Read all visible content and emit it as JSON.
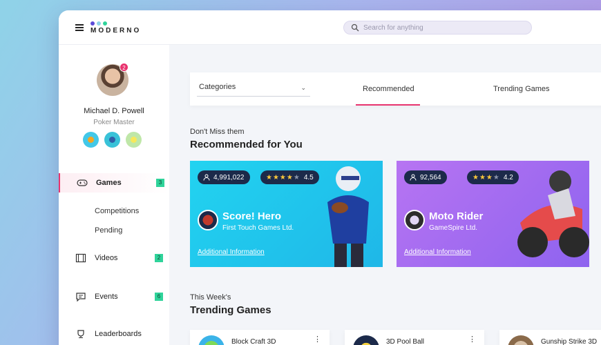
{
  "app": {
    "brand": "MODERNO",
    "search_placeholder": "Search for anything",
    "logo_colors": [
      "#5c4bd8",
      "#8fd3e8",
      "#2fd39a"
    ]
  },
  "user": {
    "name": "Michael D. Powell",
    "role": "Poker Master",
    "notification_count": "2"
  },
  "sidebar": {
    "items": [
      {
        "label": "Games",
        "count": "3",
        "icon": "gamepad-icon"
      },
      {
        "label": "Competitions"
      },
      {
        "label": "Pending"
      },
      {
        "label": "Videos",
        "count": "2",
        "icon": "film-icon"
      },
      {
        "label": "Events",
        "count": "6",
        "icon": "chat-icon"
      },
      {
        "label": "Leaderboards",
        "icon": "trophy-icon"
      }
    ]
  },
  "filters": {
    "category_label": "Categories"
  },
  "tabs": [
    {
      "label": "Recommended",
      "active": true
    },
    {
      "label": "Trending Games"
    }
  ],
  "recommended": {
    "kicker": "Don't Miss them",
    "title": "Recommended for You",
    "cards": [
      {
        "players": "4,991,022",
        "rating": "4.5",
        "title": "Score! Hero",
        "developer": "First Touch Games Ltd.",
        "link": "Additional Information",
        "accent": "#22d3f0"
      },
      {
        "players": "92,564",
        "rating": "4.2",
        "title": "Moto Rider",
        "developer": "GameSpire Ltd.",
        "link": "Additional Information",
        "accent": "#b774f2"
      }
    ]
  },
  "trending": {
    "kicker": "This Week's",
    "title": "Trending Games",
    "items": [
      {
        "title": "Block Craft 3D"
      },
      {
        "title": "3D Pool Ball"
      },
      {
        "title": "Gunship Strike 3D"
      }
    ]
  }
}
